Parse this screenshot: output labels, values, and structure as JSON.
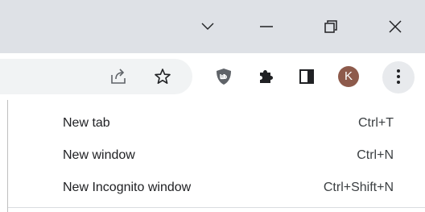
{
  "window_controls": {
    "tab_search_icon": "chevron-down",
    "minimize_icon": "minimize",
    "restore_icon": "restore",
    "close_icon": "close"
  },
  "toolbar": {
    "share_icon": "share",
    "bookmark_icon": "star",
    "extensions": [
      "ublock-shield",
      "puzzle-extensions",
      "side-panel"
    ],
    "profile_initial": "K",
    "profile_color": "#8d5a4b",
    "menu_icon": "three-dot-vertical"
  },
  "menu": {
    "items": [
      {
        "label": "New tab",
        "shortcut": "Ctrl+T"
      },
      {
        "label": "New window",
        "shortcut": "Ctrl+N"
      },
      {
        "label": "New Incognito window",
        "shortcut": "Ctrl+Shift+N"
      }
    ]
  },
  "colors": {
    "titlebar": "#dee1e6",
    "omnibox": "#f1f3f4",
    "menu_button_hover": "#e8eaed",
    "text": "#202124"
  }
}
